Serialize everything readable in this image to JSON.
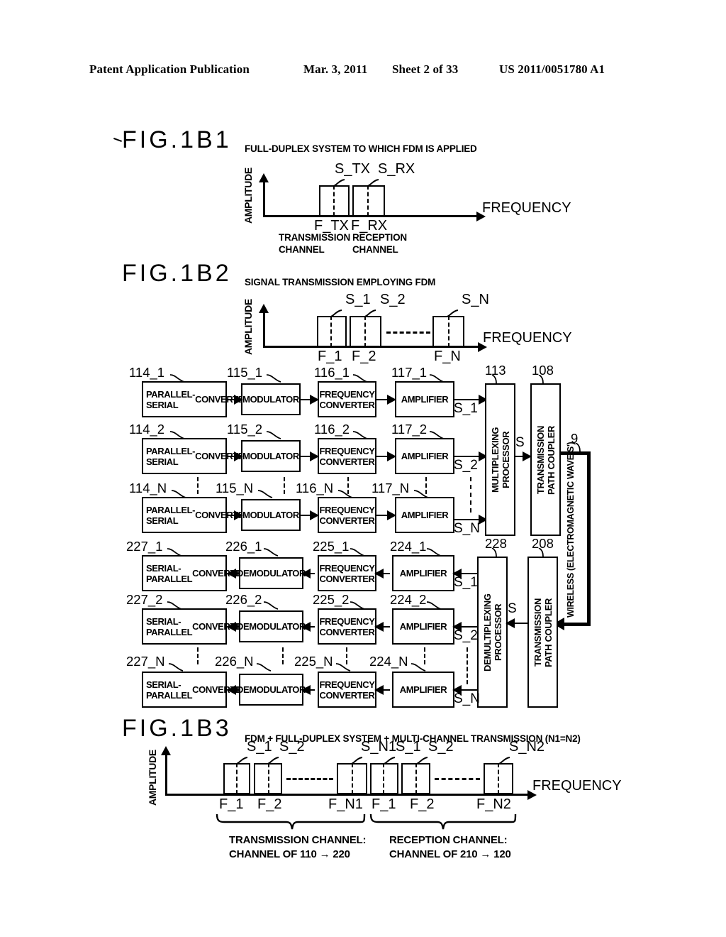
{
  "header": {
    "publication": "Patent Application Publication",
    "date": "Mar. 3, 2011",
    "sheet": "Sheet 2 of 33",
    "patent_number": "US 2011/0051780 A1"
  },
  "fig1b1": {
    "label": "FIG.1B1",
    "caption": "FULL-DUPLEX SYSTEM TO WHICH FDM IS APPLIED",
    "y_axis": "AMPLITUDE",
    "x_axis": "FREQUENCY",
    "signals": [
      "S_TX",
      "S_RX"
    ],
    "freq_ticks": [
      "F_TX",
      "F_RX"
    ],
    "note_tx_1": "TRANSMISSION",
    "note_tx_2": "CHANNEL",
    "note_rx_1": "RECEPTION",
    "note_rx_2": "CHANNEL"
  },
  "fig1b2": {
    "label": "FIG.1B2",
    "caption": "SIGNAL TRANSMISSION EMPLOYING FDM",
    "y_axis": "AMPLITUDE",
    "x_axis": "FREQUENCY",
    "signals": [
      "S_1",
      "S_2",
      "S_N"
    ],
    "freq_ticks": [
      "F_1",
      "F_2",
      "F_N"
    ]
  },
  "fig1b3": {
    "label": "FIG.1B3",
    "caption": "FDM + FULL-DUPLEX SYSTEM + MULTI-CHANNEL TRANSMISSION (N1=N2)",
    "y_axis": "AMPLITUDE",
    "x_axis": "FREQUENCY",
    "signals": [
      "S_1",
      "S_2",
      "S_N1",
      "S_1",
      "S_2",
      "S_N2"
    ],
    "freq_ticks": [
      "F_1",
      "F_2",
      "F_N1",
      "F_1",
      "F_2",
      "F_N2"
    ],
    "brace_tx_1": "TRANSMISSION CHANNEL:",
    "brace_tx_2": "CHANNEL OF 110 → 220",
    "brace_rx_1": "RECEPTION CHANNEL:",
    "brace_rx_2": "CHANNEL OF 210 → 120"
  },
  "block_diagram": {
    "tx_rows": [
      {
        "refs": [
          "114_1",
          "115_1",
          "116_1",
          "117_1"
        ],
        "blocks": [
          "PARALLEL-SERIAL CONVERTER",
          "MODULATOR",
          "FREQUENCY CONVERTER",
          "AMPLIFIER"
        ],
        "signal": "S_1"
      },
      {
        "refs": [
          "114_2",
          "115_2",
          "116_2",
          "117_2"
        ],
        "blocks": [
          "PARALLEL-SERIAL CONVERTER",
          "MODULATOR",
          "FREQUENCY CONVERTER",
          "AMPLIFIER"
        ],
        "signal": "S_2"
      },
      {
        "refs": [
          "114_N",
          "115_N",
          "116_N",
          "117_N"
        ],
        "blocks": [
          "PARALLEL-SERIAL CONVERTER",
          "MODULATOR",
          "FREQUENCY CONVERTER",
          "AMPLIFIER"
        ],
        "signal": "S_N"
      }
    ],
    "rx_rows": [
      {
        "refs": [
          "227_1",
          "226_1",
          "225_1",
          "224_1"
        ],
        "blocks": [
          "SERIAL-PARALLEL CONVERTER",
          "DEMODULATOR",
          "FREQUENCY CONVERTER",
          "AMPLIFIER"
        ],
        "signal": "S_1"
      },
      {
        "refs": [
          "227_2",
          "226_2",
          "225_2",
          "224_2"
        ],
        "blocks": [
          "SERIAL-PARALLEL CONVERTER",
          "DEMODULATOR",
          "FREQUENCY CONVERTER",
          "AMPLIFIER"
        ],
        "signal": "S_2"
      },
      {
        "refs": [
          "227_N",
          "226_N",
          "225_N",
          "224_N"
        ],
        "blocks": [
          "SERIAL-PARALLEL CONVERTER",
          "DEMODULATOR",
          "FREQUENCY CONVERTER",
          "AMPLIFIER"
        ],
        "signal": "S_N"
      }
    ],
    "mux": {
      "ref": "113",
      "line1": "MULTIPLEXING",
      "line2": "PROCESSOR"
    },
    "demux": {
      "ref": "228",
      "line1": "DEMULTIPLEXING",
      "line2": "PROCESSOR"
    },
    "tx_coupler": {
      "ref": "108",
      "line1": "TRANSMISSION",
      "line2": "PATH COUPLER"
    },
    "rx_coupler": {
      "ref": "208",
      "line1": "TRANSMISSION",
      "line2": "PATH COUPLER"
    },
    "mux_out_signal": "S",
    "demux_in_signal": "S",
    "wireless": {
      "ref": "9",
      "label": "WIRELESS (ELECTROMAGNETIC WAVE S')"
    }
  },
  "parallel_serial_lines": [
    "PARALLEL-SERIAL",
    "CONVERTER"
  ],
  "serial_parallel_lines": [
    "SERIAL-PARALLEL",
    "CONVERTER"
  ],
  "freq_conv_lines": [
    "FREQUENCY",
    "CONVERTER"
  ],
  "modulator_label": "MODULATOR",
  "demodulator_label": "DEMODULATOR",
  "amplifier_label": "AMPLIFIER"
}
